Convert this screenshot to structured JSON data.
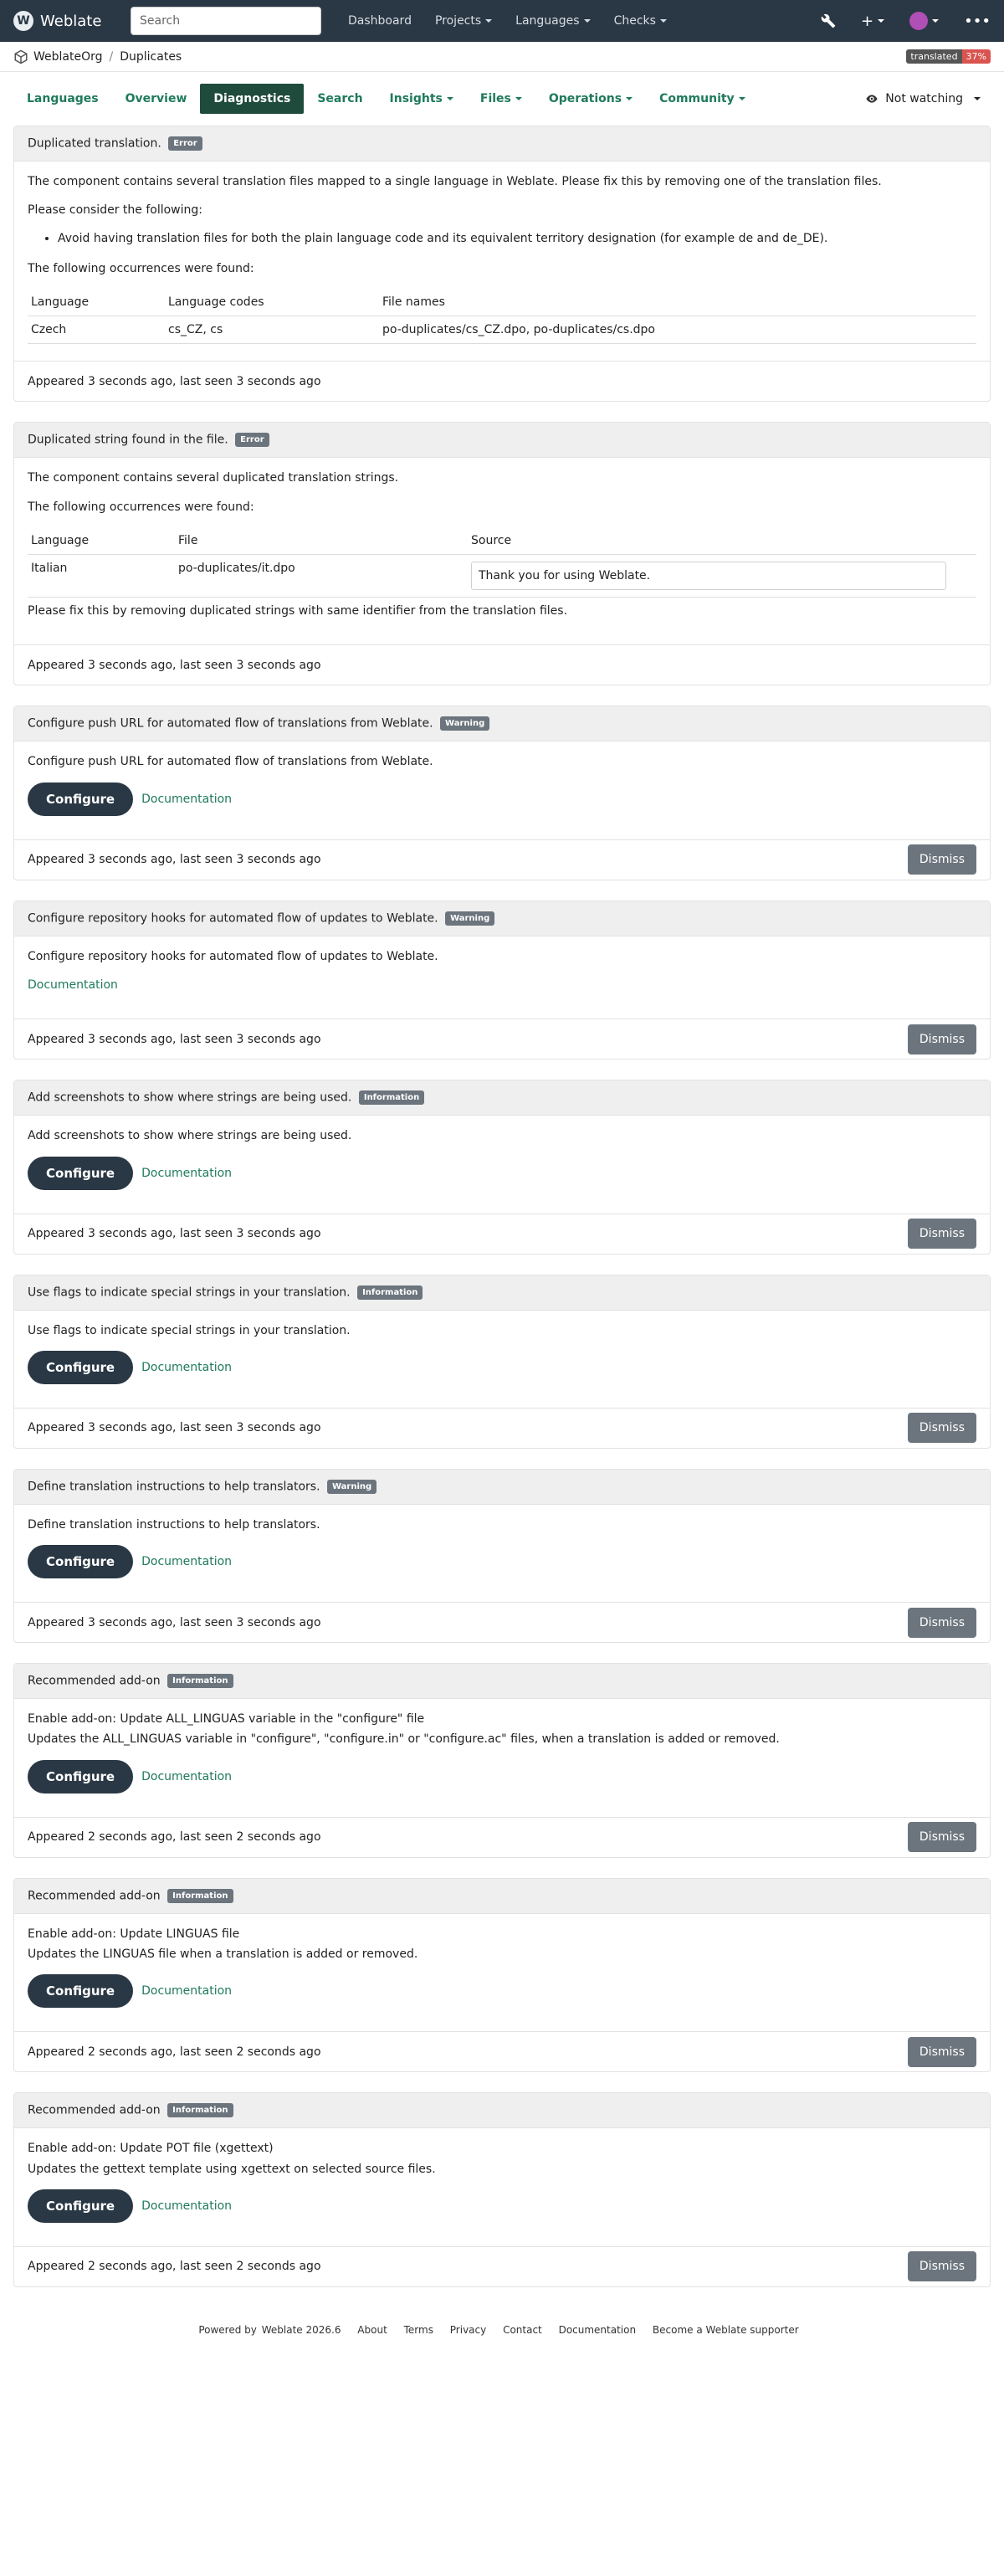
{
  "topbar": {
    "brand": "Weblate",
    "search_placeholder": "Search",
    "nav": [
      "Dashboard",
      "Projects",
      "Languages",
      "Checks"
    ]
  },
  "breadcrumb": {
    "project": "WeblateOrg",
    "component": "Duplicates",
    "badge_label": "translated",
    "badge_value": "37%"
  },
  "tabs": {
    "items": [
      "Languages",
      "Overview",
      "Diagnostics",
      "Search",
      "Insights",
      "Files",
      "Operations",
      "Community"
    ],
    "watch": "Not watching"
  },
  "panels": [
    {
      "title": "Duplicated translation.",
      "level": "Error",
      "intro": "The component contains several translation files mapped to a single language in Weblate. Please fix this by removing one of the translation files.",
      "consider": "Please consider the following:",
      "bullet": "Avoid having translation files for both the plain language code and its equivalent territory designation (for example de and de_DE).",
      "occ": "The following occurrences were found:",
      "headers": [
        "Language",
        "Language codes",
        "File names"
      ],
      "row": [
        "Czech",
        "cs_CZ, cs",
        "po-duplicates/cs_CZ.dpo, po-duplicates/cs.dpo"
      ],
      "footer": "Appeared 3 seconds ago, last seen 3 seconds ago"
    },
    {
      "title": "Duplicated string found in the file.",
      "level": "Error",
      "intro": "The component contains several duplicated translation strings.",
      "occ": "The following occurrences were found:",
      "headers": [
        "Language",
        "File",
        "Source"
      ],
      "row": [
        "Italian",
        "po-duplicates/it.dpo",
        "Thank you for using Weblate."
      ],
      "fix": "Please fix this by removing duplicated strings with same identifier from the translation files.",
      "footer": "Appeared 3 seconds ago, last seen 3 seconds ago"
    },
    {
      "title": "Configure push URL for automated flow of translations from Weblate.",
      "level": "Warning",
      "body": "Configure push URL for automated flow of translations from Weblate.",
      "configure": "Configure",
      "doc": "Documentation",
      "footer": "Appeared 3 seconds ago, last seen 3 seconds ago",
      "dismiss": "Dismiss"
    },
    {
      "title": "Configure repository hooks for automated flow of updates to Weblate.",
      "level": "Warning",
      "body": "Configure repository hooks for automated flow of updates to Weblate.",
      "doc": "Documentation",
      "footer": "Appeared 3 seconds ago, last seen 3 seconds ago",
      "dismiss": "Dismiss"
    },
    {
      "title": "Add screenshots to show where strings are being used.",
      "level": "Information",
      "body": "Add screenshots to show where strings are being used.",
      "configure": "Configure",
      "doc": "Documentation",
      "footer": "Appeared 3 seconds ago, last seen 3 seconds ago",
      "dismiss": "Dismiss"
    },
    {
      "title": "Use flags to indicate special strings in your translation.",
      "level": "Information",
      "body": "Use flags to indicate special strings in your translation.",
      "configure": "Configure",
      "doc": "Documentation",
      "footer": "Appeared 3 seconds ago, last seen 3 seconds ago",
      "dismiss": "Dismiss"
    },
    {
      "title": "Define translation instructions to help translators.",
      "level": "Warning",
      "body": "Define translation instructions to help translators.",
      "configure": "Configure",
      "doc": "Documentation",
      "footer": "Appeared 3 seconds ago, last seen 3 seconds ago",
      "dismiss": "Dismiss"
    },
    {
      "title": "Recommended add-on",
      "level": "Information",
      "line1": "Enable add-on: Update ALL_LINGUAS variable in the \"configure\" file",
      "line2": "Updates the ALL_LINGUAS variable in \"configure\", \"configure.in\" or \"configure.ac\" files, when a translation is added or removed.",
      "configure": "Configure",
      "doc": "Documentation",
      "footer": "Appeared 2 seconds ago, last seen 2 seconds ago",
      "dismiss": "Dismiss"
    },
    {
      "title": "Recommended add-on",
      "level": "Information",
      "line1": "Enable add-on: Update LINGUAS file",
      "line2": "Updates the LINGUAS file when a translation is added or removed.",
      "configure": "Configure",
      "doc": "Documentation",
      "footer": "Appeared 2 seconds ago, last seen 2 seconds ago",
      "dismiss": "Dismiss"
    },
    {
      "title": "Recommended add-on",
      "level": "Information",
      "line1": "Enable add-on: Update POT file (xgettext)",
      "line2": "Updates the gettext template using xgettext on selected source files.",
      "configure": "Configure",
      "doc": "Documentation",
      "footer": "Appeared 2 seconds ago, last seen 2 seconds ago",
      "dismiss": "Dismiss"
    }
  ],
  "footer": {
    "powered": "Powered by",
    "version": "Weblate 2026.6",
    "links": [
      "About",
      "Terms",
      "Privacy",
      "Contact",
      "Documentation",
      "Become a Weblate supporter"
    ]
  }
}
